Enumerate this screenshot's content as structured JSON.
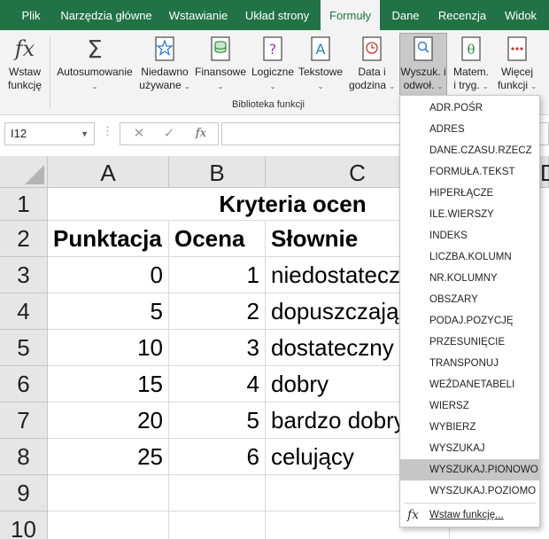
{
  "ribbon_tabs": [
    {
      "label": "Plik"
    },
    {
      "label": "Narzędzia główne"
    },
    {
      "label": "Wstawianie"
    },
    {
      "label": "Układ strony"
    },
    {
      "label": "Formuły",
      "active": true
    },
    {
      "label": "Dane"
    },
    {
      "label": "Recenzja"
    },
    {
      "label": "Widok"
    }
  ],
  "ribbon": {
    "insert_function": {
      "line1": "Wstaw",
      "line2": "funkcję"
    },
    "autosum": {
      "line1": "Autosumowanie"
    },
    "recent": {
      "line1": "Niedawno",
      "line2": "używane"
    },
    "financial": {
      "line1": "Finansowe"
    },
    "logical": {
      "line1": "Logiczne"
    },
    "text": {
      "line1": "Tekstowe"
    },
    "datetime": {
      "line1": "Data i",
      "line2": "godzina"
    },
    "lookup": {
      "line1": "Wyszuk. i",
      "line2": "odwoł."
    },
    "math": {
      "line1": "Matem.",
      "line2": "i tryg."
    },
    "more": {
      "line1": "Więcej",
      "line2": "funkcji"
    },
    "group_label": "Biblioteka funkcji"
  },
  "formula_bar": {
    "name_box": "I12",
    "formula": ""
  },
  "grid": {
    "columns": [
      "A",
      "B",
      "C",
      "D"
    ],
    "rows": [
      "1",
      "2",
      "3",
      "4",
      "5",
      "6",
      "7",
      "8",
      "9",
      "10"
    ],
    "title": "Kryteria ocen",
    "headers": [
      "Punktacja",
      "Ocena",
      "Słownie"
    ],
    "data": [
      {
        "points": "0",
        "grade": "1",
        "words": "niedostateczny"
      },
      {
        "points": "5",
        "grade": "2",
        "words": "dopuszczający"
      },
      {
        "points": "10",
        "grade": "3",
        "words": "dostateczny"
      },
      {
        "points": "15",
        "grade": "4",
        "words": "dobry"
      },
      {
        "points": "20",
        "grade": "5",
        "words": "bardzo dobry"
      },
      {
        "points": "25",
        "grade": "6",
        "words": "celujący"
      }
    ]
  },
  "lookup_menu": {
    "items": [
      "ADR.POŚR",
      "ADRES",
      "DANE.CZASU.RZECZ",
      "FORMUŁA.TEKST",
      "HIPERŁĄCZE",
      "ILE.WIERSZY",
      "INDEKS",
      "LICZBA.KOLUMN",
      "NR.KOLUMNY",
      "OBSZARY",
      "PODAJ.POZYCJĘ",
      "PRZESUNIĘCIE",
      "TRANSPONUJ",
      "WEŹDANETABELI",
      "WIERSZ",
      "WYBIERZ",
      "WYSZUKAJ",
      "WYSZUKAJ.PIONOWO",
      "WYSZUKAJ.POZIOMO"
    ],
    "highlighted": "WYSZUKAJ.PIONOWO",
    "insert_function": "Wstaw funkcję..."
  },
  "colors": {
    "ribbon_green": "#217346",
    "menu_highlight": "#c6c6c6"
  }
}
